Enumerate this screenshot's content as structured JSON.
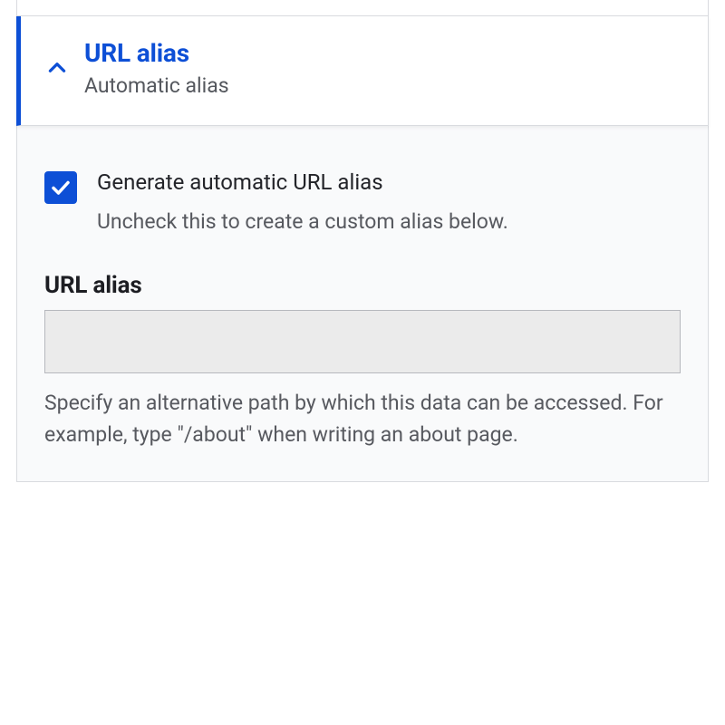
{
  "accordion": {
    "title": "URL alias",
    "subtitle": "Automatic alias"
  },
  "checkbox": {
    "checked": true,
    "label": "Generate automatic URL alias",
    "description": "Uncheck this to create a custom alias below."
  },
  "field": {
    "label": "URL alias",
    "value": "",
    "help": "Specify an alternative path by which this data can be accessed. For example, type \"/about\" when writing an about page."
  }
}
